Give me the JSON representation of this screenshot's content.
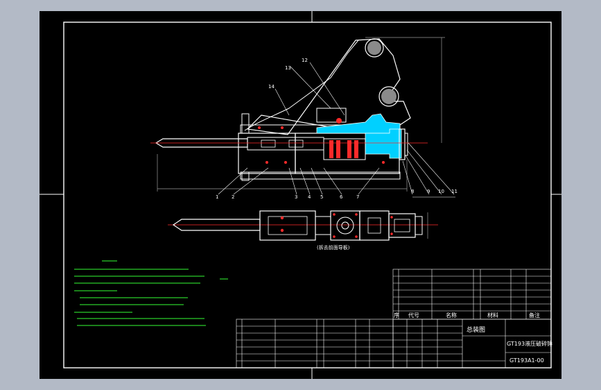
{
  "drawing": {
    "title_block": {
      "drawing_type": "总装图",
      "product_name": "GT193液压破碎锤",
      "drawing_number": "GT193A1-00"
    },
    "bom_header": {
      "col_seq": "序",
      "col_code": "代号",
      "col_name": "名称",
      "col_material": "材料",
      "col_remark": "备注"
    },
    "view_caption": "(拆去前面导板)",
    "part_callouts": [
      "1",
      "2",
      "3",
      "4",
      "5",
      "6",
      "7",
      "8",
      "9",
      "10",
      "11",
      "12",
      "13",
      "14"
    ]
  },
  "colors": {
    "background": "#b3bac6",
    "canvas": "#000000",
    "outline": "#ffffff",
    "cylinder": "#00d0ff",
    "accent_red": "#ff2a2a",
    "dimension": "#9a9a9a",
    "notes": "#33ff33",
    "table": "#ffffff"
  }
}
